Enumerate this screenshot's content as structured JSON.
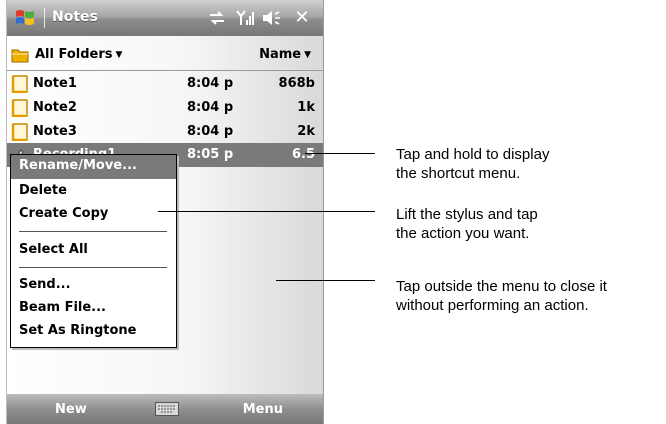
{
  "titlebar": {
    "title": "Notes",
    "start_icon": "windows-flag-icon",
    "icons": [
      "connectivity-icon",
      "signal-icon",
      "volume-icon",
      "close-icon"
    ],
    "close_glyph": "✕"
  },
  "header": {
    "folder_label": "All Folders",
    "sort_label": "Name",
    "caret": "▼"
  },
  "files": [
    {
      "name": "Note1",
      "time": "8:04 p",
      "size": "868b"
    },
    {
      "name": "Note2",
      "time": "8:04 p",
      "size": "1k"
    },
    {
      "name": "Note3",
      "time": "8:04 p",
      "size": "2k"
    },
    {
      "name": "Recording1",
      "time": "8:05 p",
      "size": "6.5"
    }
  ],
  "context_menu": {
    "items": [
      "Rename/Move...",
      "Delete",
      "Create Copy",
      "Select All",
      "Send...",
      "Beam File...",
      "Set As Ringtone"
    ]
  },
  "bottombar": {
    "left_softkey": "New",
    "right_softkey": "Menu"
  },
  "callouts": [
    {
      "line1": "Tap and hold to display",
      "line2": "the shortcut menu."
    },
    {
      "line1": "Lift the stylus and tap",
      "line2": "the action you want."
    },
    {
      "line1": "Tap outside the menu to close it",
      "line2": "without performing an action."
    }
  ],
  "colors": {
    "selection": "#7a7a7a",
    "titlebar": "#8d8d8d",
    "folder": "#f2a500"
  }
}
